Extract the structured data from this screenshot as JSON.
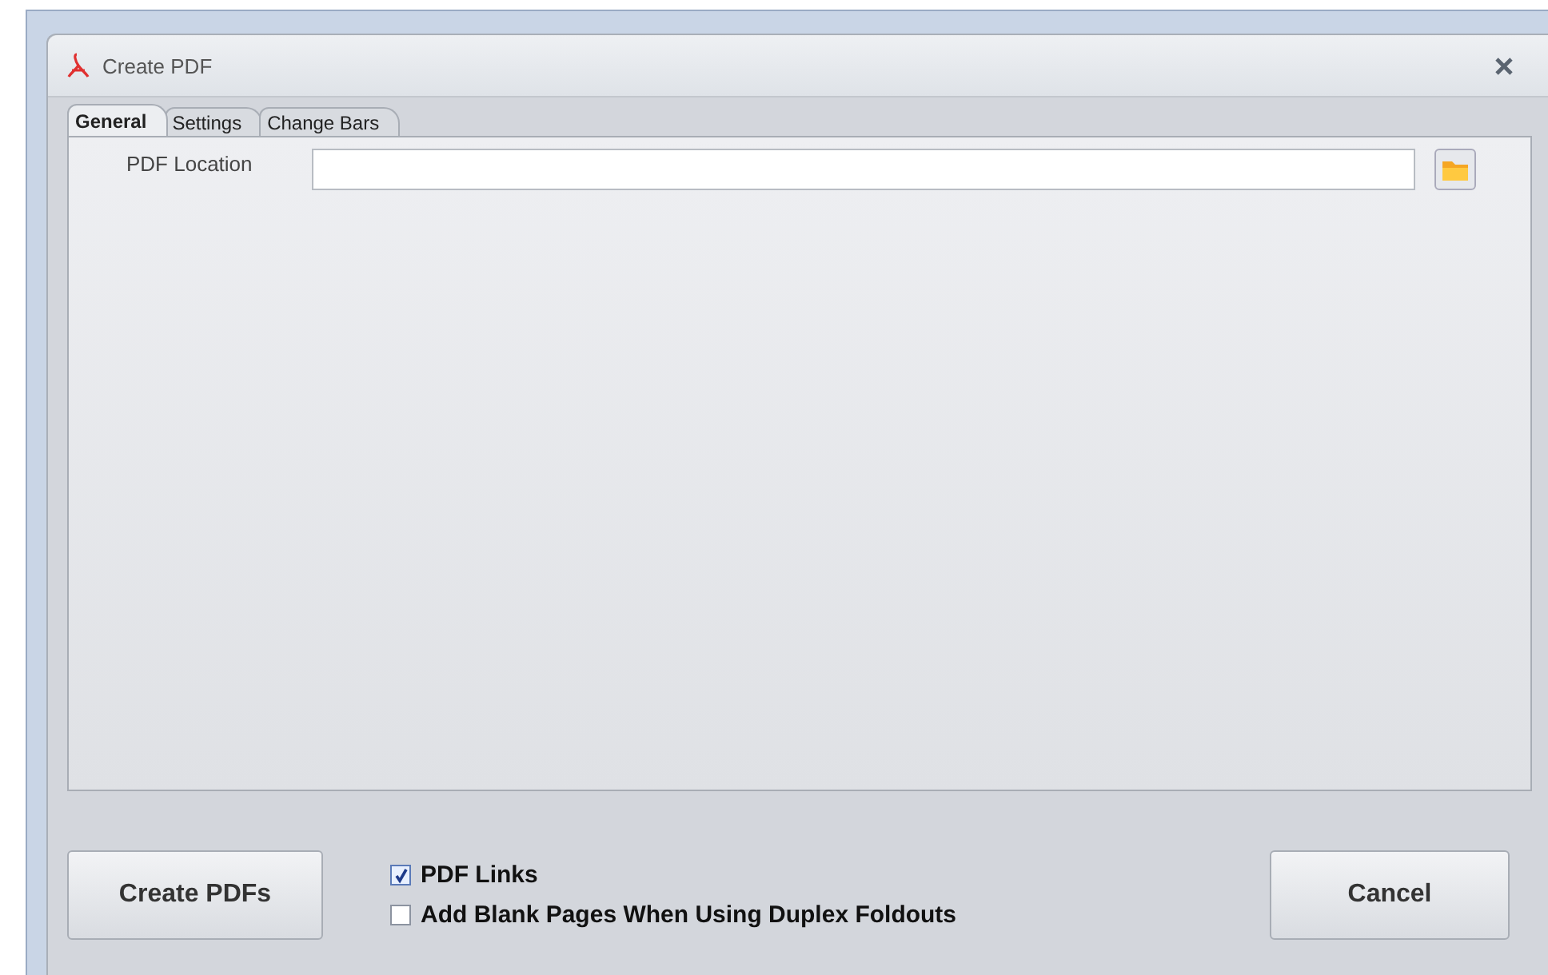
{
  "window": {
    "title": "Create PDF"
  },
  "tabs": [
    {
      "label": "General",
      "selected": true
    },
    {
      "label": "Settings",
      "selected": false
    },
    {
      "label": "Change Bars",
      "selected": false
    }
  ],
  "pdf_location": {
    "label": "PDF Location"
  },
  "create_button": "Create PDFs",
  "options": [
    {
      "label": "PDF Links",
      "checked": true
    },
    {
      "label": "Add Blank Pages When Using Duplex Foldouts",
      "checked": false
    }
  ],
  "cancel_button": "Cancel"
}
